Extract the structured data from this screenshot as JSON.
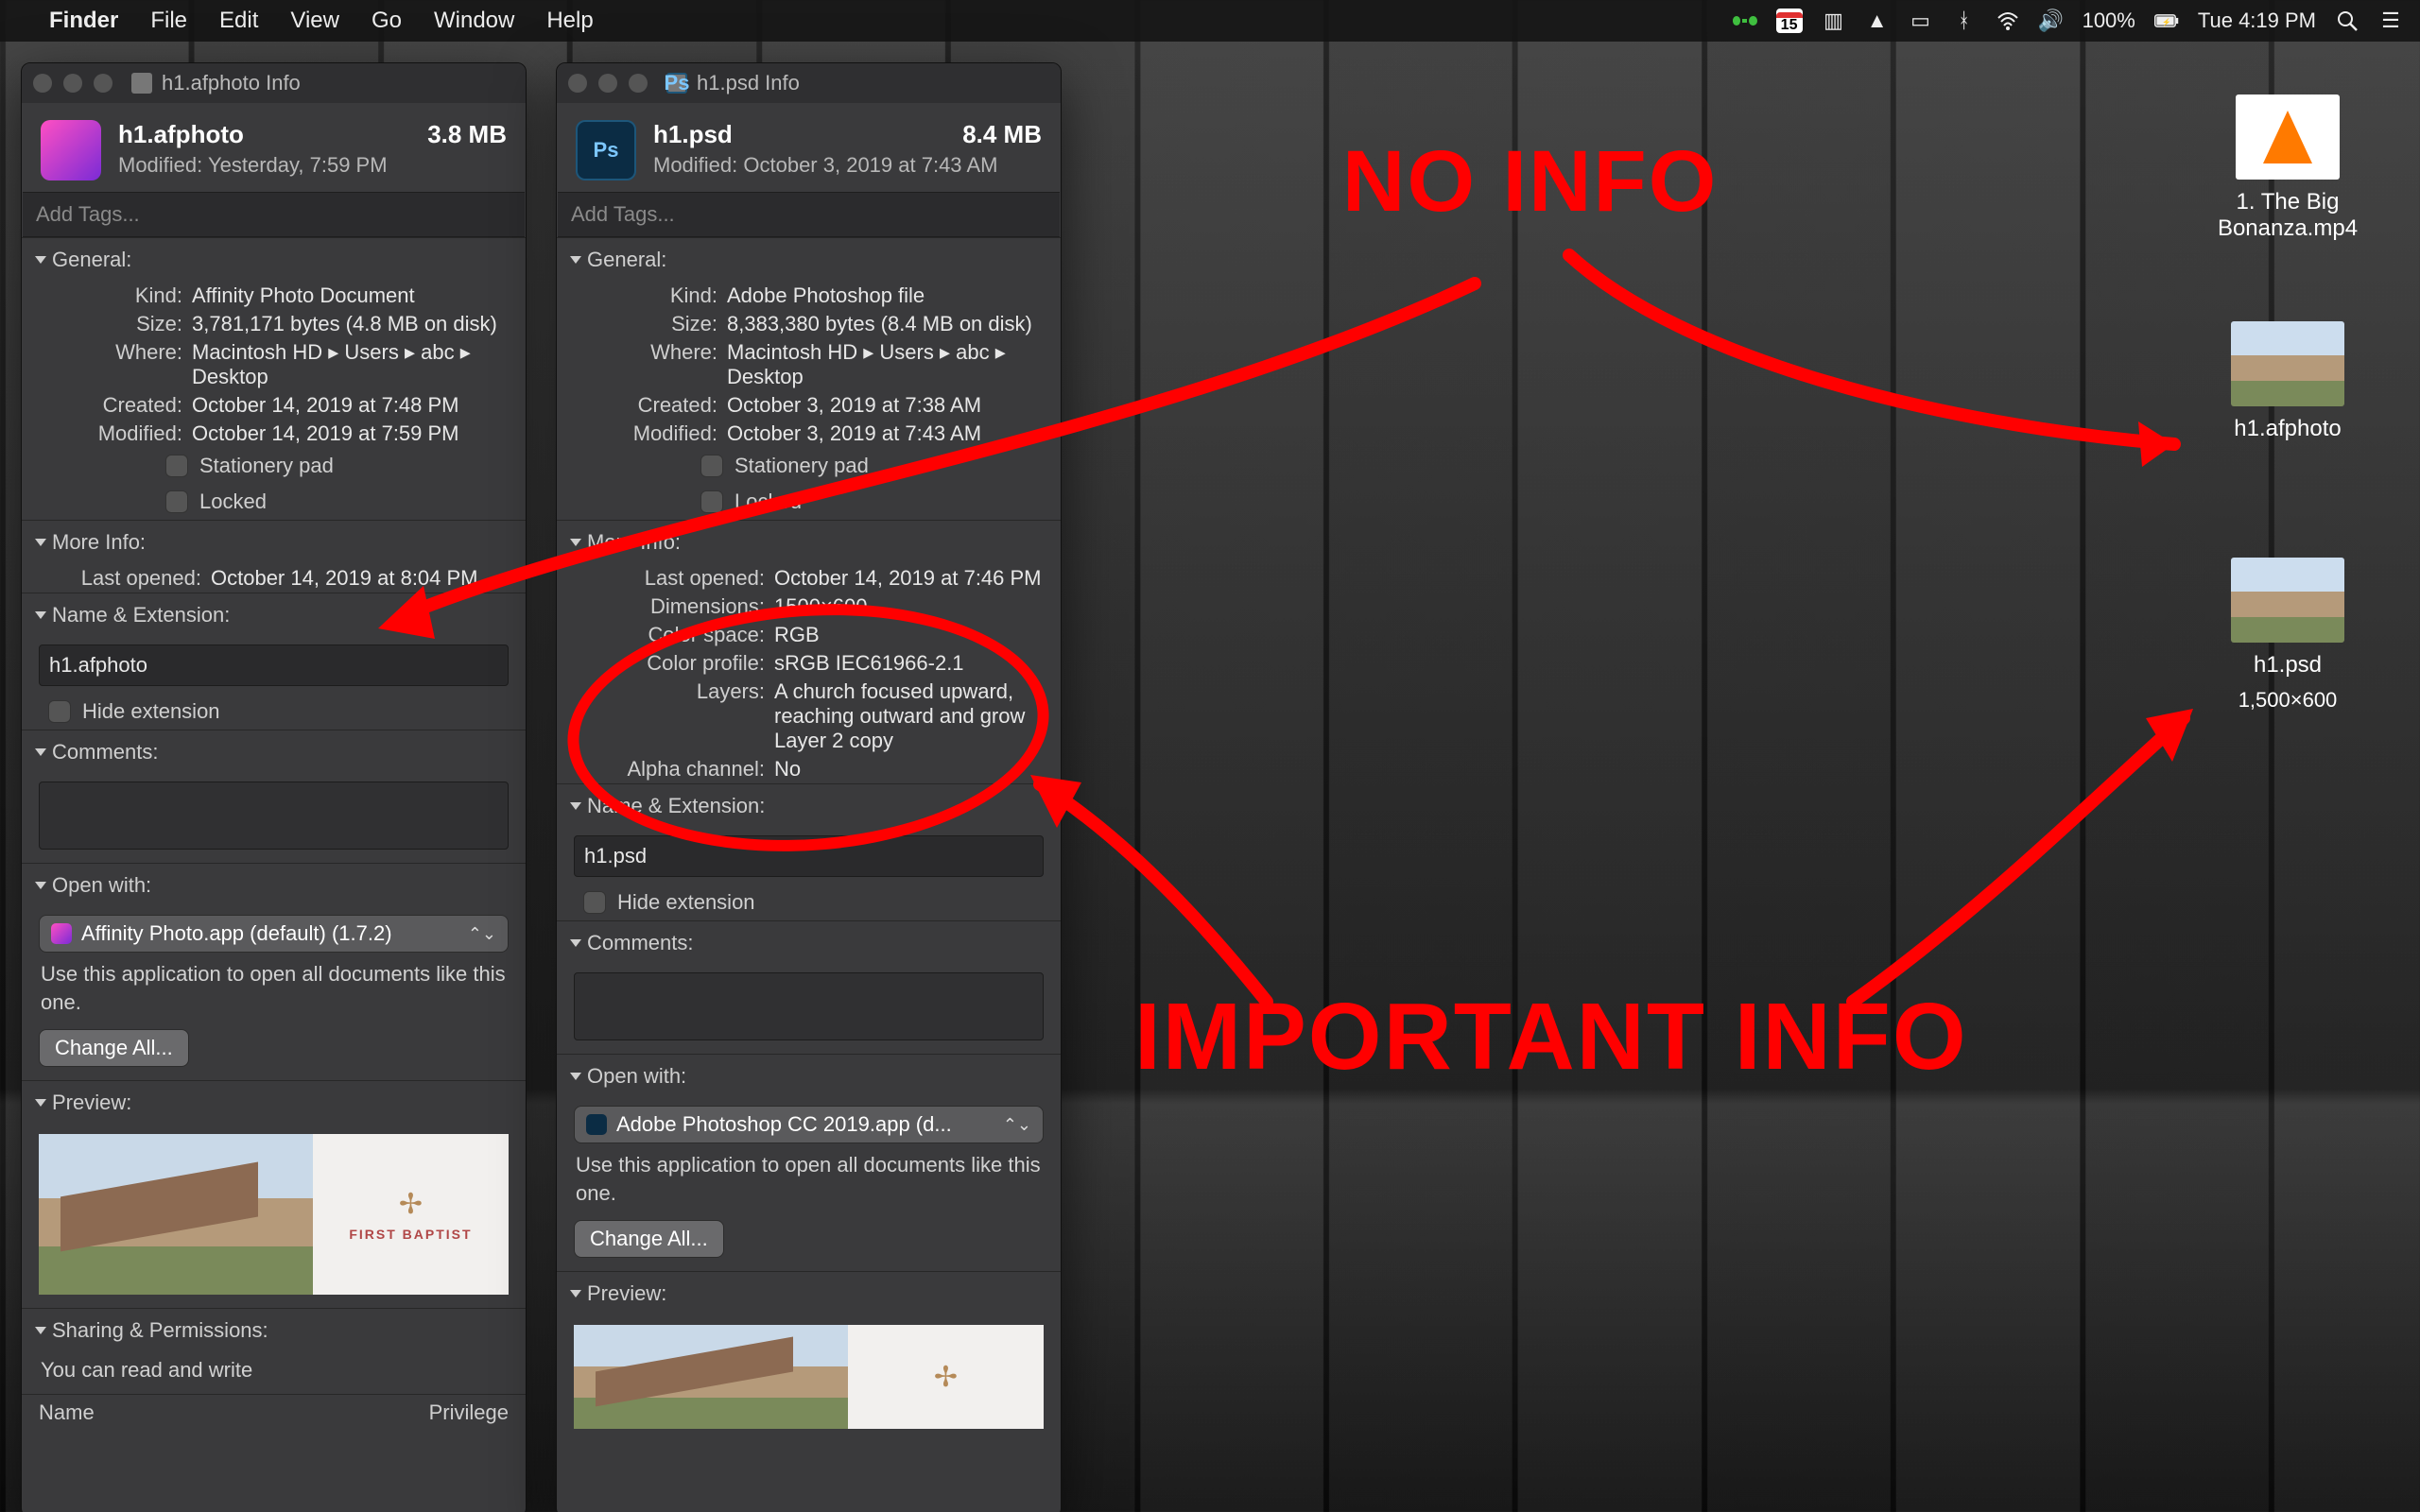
{
  "menubar": {
    "app": "Finder",
    "items": [
      "File",
      "Edit",
      "View",
      "Go",
      "Window",
      "Help"
    ],
    "calendar_day": "15",
    "battery_pct": "100%",
    "clock": "Tue 4:19 PM"
  },
  "annotations": {
    "no_info": "NO INFO",
    "important": "IMPORTANT INFO"
  },
  "desktop_icons": {
    "vlc": {
      "line1": "1. The Big",
      "line2": "Bonanza.mp4"
    },
    "afphoto": {
      "name": "h1.afphoto"
    },
    "psd": {
      "name": "h1.psd",
      "dims": "1,500×600"
    }
  },
  "common": {
    "tags_placeholder": "Add Tags...",
    "general": "General:",
    "kind": "Kind:",
    "size": "Size:",
    "where": "Where:",
    "created": "Created:",
    "modified_lbl": "Modified:",
    "stationery": "Stationery pad",
    "locked": "Locked",
    "more_info": "More Info:",
    "last_opened": "Last opened:",
    "dimensions": "Dimensions:",
    "color_space": "Color space:",
    "color_profile": "Color profile:",
    "layers": "Layers:",
    "alpha": "Alpha channel:",
    "name_ext": "Name & Extension:",
    "hide_ext": "Hide extension",
    "comments": "Comments:",
    "open_with": "Open with:",
    "open_hint": "Use this application to open all documents like this one.",
    "change_all": "Change All...",
    "preview": "Preview:",
    "sharing": "Sharing & Permissions:",
    "rw": "You can read and write",
    "col_name": "Name",
    "col_priv": "Privilege"
  },
  "win_a": {
    "title": "h1.afphoto Info",
    "filename": "h1.afphoto",
    "filesize": "3.8 MB",
    "modified": "Modified: Yesterday, 7:59 PM",
    "kind": "Affinity Photo Document",
    "size": "3,781,171 bytes (4.8 MB on disk)",
    "where": "Macintosh HD ▸ Users ▸ abc ▸ Desktop",
    "created": "October 14, 2019 at 7:48 PM",
    "modified_full": "October 14, 2019 at 7:59 PM",
    "last_opened": "October 14, 2019 at 8:04 PM",
    "name_value": "h1.afphoto",
    "open_with_app": "Affinity Photo.app (default) (1.7.2)"
  },
  "win_b": {
    "title": "h1.psd Info",
    "filename": "h1.psd",
    "filesize": "8.4 MB",
    "modified": "Modified: October 3, 2019 at 7:43 AM",
    "kind": "Adobe Photoshop file",
    "size": "8,383,380 bytes (8.4 MB on disk)",
    "where": "Macintosh HD ▸ Users ▸ abc ▸ Desktop",
    "created": "October 3, 2019 at 7:38 AM",
    "modified_full": "October 3, 2019 at 7:43 AM",
    "last_opened": "October 14, 2019 at 7:46 PM",
    "dimensions": "1500×600",
    "color_space": "RGB",
    "color_profile": "sRGB IEC61966-2.1",
    "layers_1": "A church focused upward,",
    "layers_2": "reaching outward        and grow",
    "layers_3": "Layer 2 copy",
    "alpha": "No",
    "name_value": "h1.psd",
    "open_with_app": "Adobe Photoshop CC 2019.app (d..."
  }
}
